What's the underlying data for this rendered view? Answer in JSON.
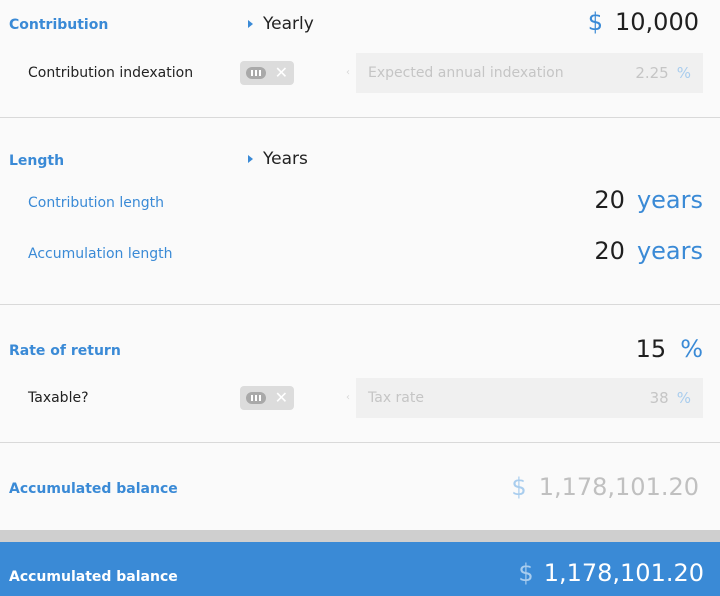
{
  "contribution": {
    "label": "Contribution",
    "frequency": "Yearly",
    "currency": "$",
    "amount": "10,000",
    "indexation_label": "Contribution indexation",
    "indexation_placeholder": "Expected annual indexation",
    "indexation_value": "2.25",
    "indexation_unit": "%"
  },
  "length": {
    "label": "Length",
    "unit_selector": "Years",
    "contribution_length_label": "Contribution length",
    "contribution_length_value": "20",
    "contribution_length_unit": "years",
    "accumulation_length_label": "Accumulation length",
    "accumulation_length_value": "20",
    "accumulation_length_unit": "years"
  },
  "rate": {
    "label": "Rate of return",
    "value": "15",
    "unit": "%",
    "taxable_label": "Taxable?",
    "tax_placeholder": "Tax rate",
    "tax_value": "38",
    "tax_unit": "%"
  },
  "result": {
    "label": "Accumulated balance",
    "currency": "$",
    "amount": "1,178,101.20"
  },
  "footer": {
    "label": "Accumulated balance",
    "currency": "$",
    "amount": "1,178,101.20"
  },
  "colors": {
    "accent": "#3a8ad6",
    "background": "#fafafa",
    "footer_bg": "#3a8ad6"
  }
}
